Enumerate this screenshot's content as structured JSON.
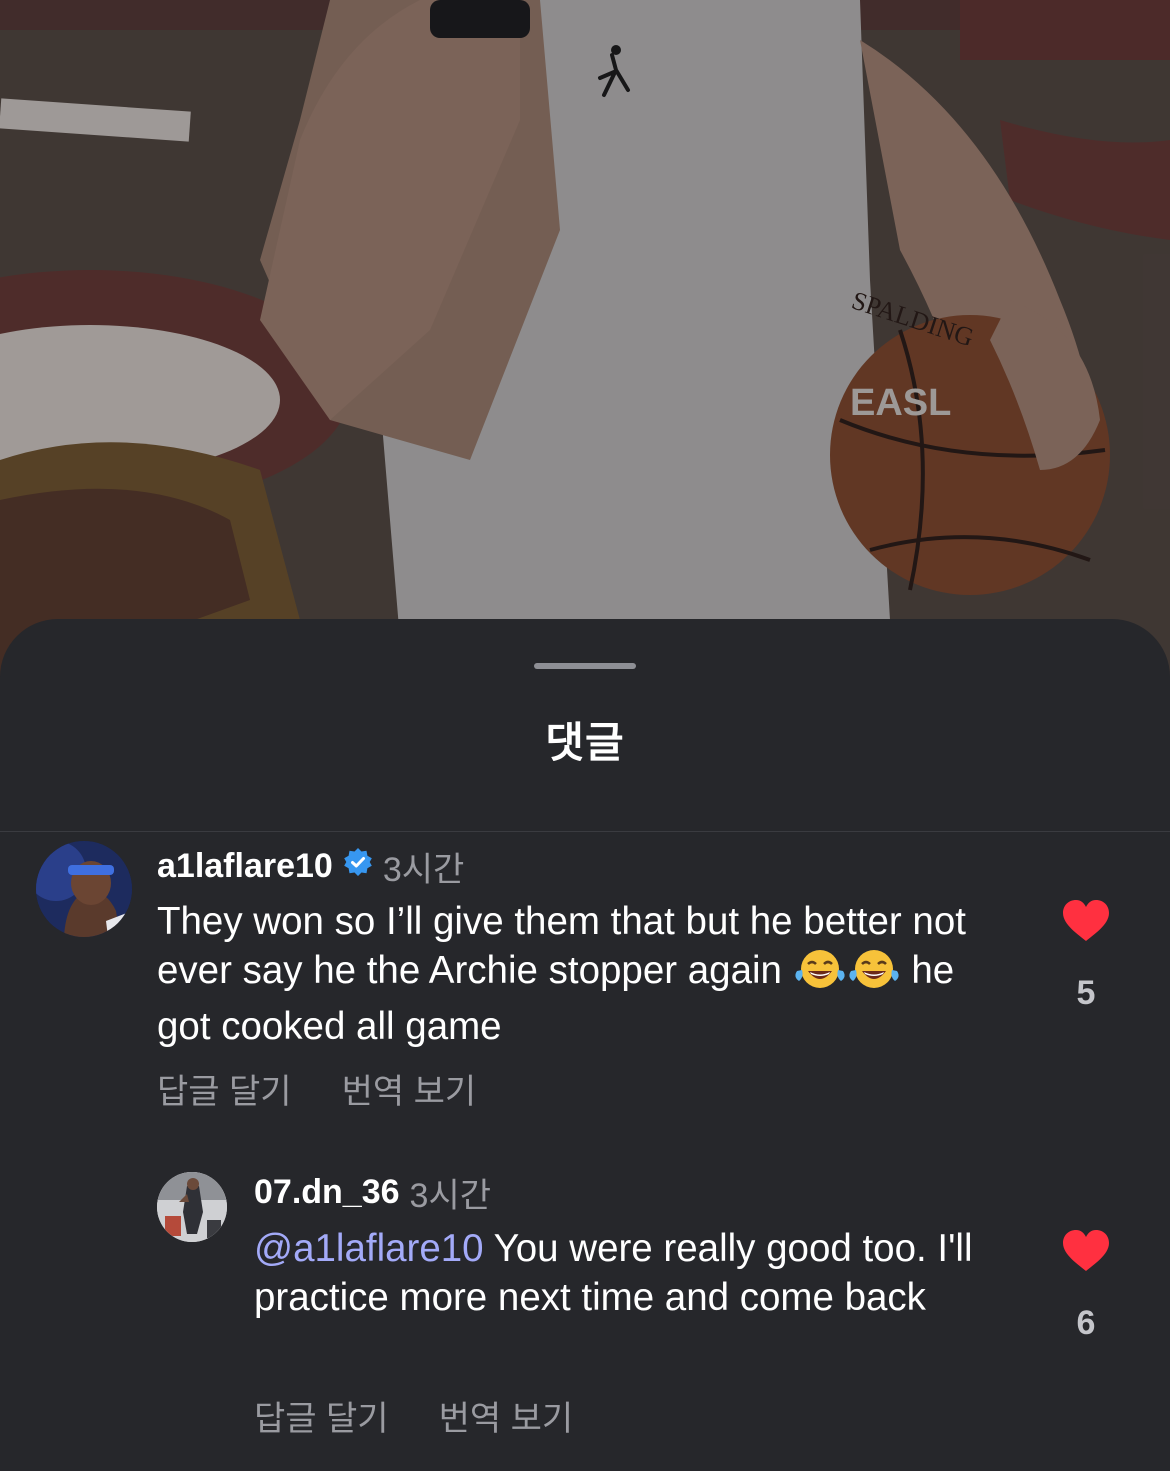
{
  "sheet": {
    "title": "댓글"
  },
  "comments": [
    {
      "username": "a1laflare10",
      "verified": true,
      "time": "3시간",
      "text_part1": "They won so I’ll give them that but he better not ever say he the Archie stopper again",
      "emoji": "face-with-tears-of-joy",
      "text_part2": "he got cooked all game",
      "actions": {
        "reply": "답글 달기",
        "translate": "번역 보기"
      },
      "liked": true,
      "like_count": "5"
    },
    {
      "username": "07.dn_36",
      "verified": false,
      "time": "3시간",
      "mention": "@a1laflare10",
      "text": "You were really good too. I'll practice more next time and come back",
      "actions": {
        "reply": "답글 달기",
        "translate": "번역 보기"
      },
      "liked": true,
      "like_count": "6"
    }
  ],
  "colors": {
    "sheet_background": "#26272b",
    "heart": "#ff3040",
    "mention": "#a3aaf8",
    "verified_badge": "#3797f0",
    "secondary_text": "#9a9ba1"
  }
}
